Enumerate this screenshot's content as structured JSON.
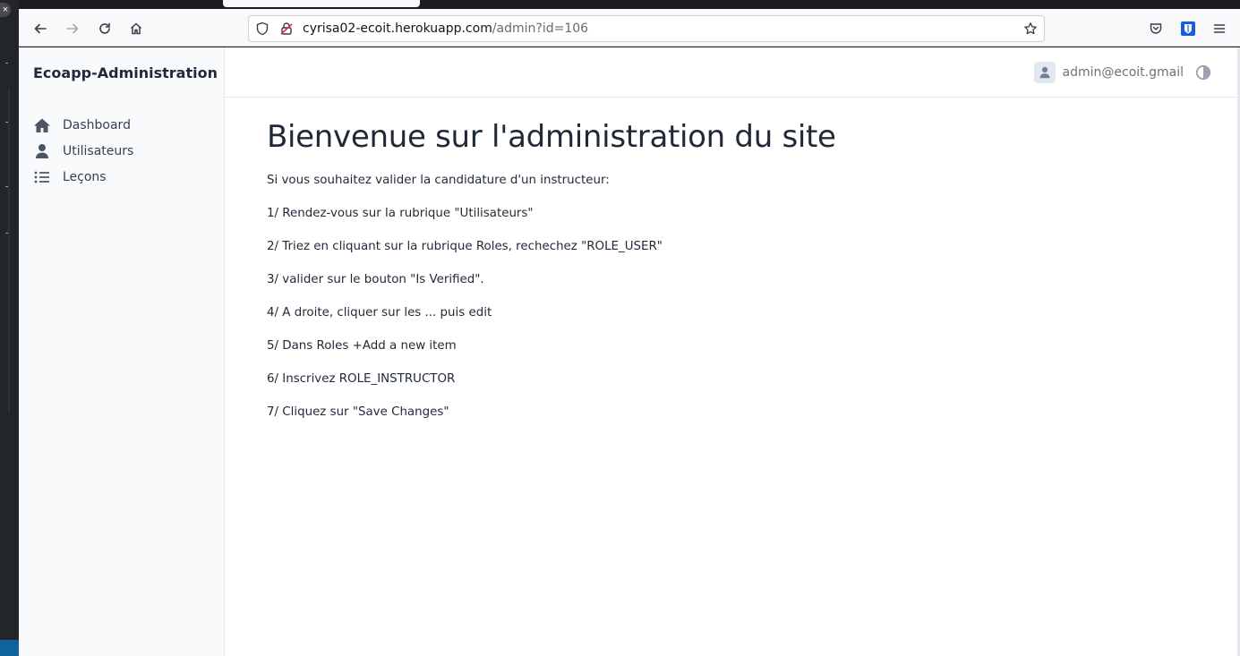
{
  "browser": {
    "url_host": "cyrisa02-ecoit.herokuapp.com",
    "url_path": "/admin?id=106",
    "left_strip_close": "×",
    "icons": [
      "back-arrow-icon",
      "forward-arrow-icon",
      "reload-icon",
      "home-icon",
      "shield-icon",
      "lock-icon",
      "star-icon",
      "pocket-icon",
      "extension-icon",
      "menu-icon"
    ]
  },
  "sidebar": {
    "brand": "Ecoapp-Administration",
    "items": [
      {
        "label": "Dashboard",
        "icon": "home-icon"
      },
      {
        "label": "Utilisateurs",
        "icon": "user-icon"
      },
      {
        "label": "Leçons",
        "icon": "list-icon"
      }
    ]
  },
  "header": {
    "user_email": "admin@ecoit.gmail",
    "avatar_icon": "user-icon",
    "theme_icon": "contrast-icon"
  },
  "main": {
    "title": "Bienvenue sur l'administration du site",
    "intro": "Si vous souhaitez valider la candidature d'un instructeur:",
    "steps": [
      "1/ Rendez-vous sur la rubrique \"Utilisateurs\"",
      "2/ Triez en cliquant sur la rubrique Roles, rechechez \"ROLE_USER\"",
      "3/ valider sur le bouton \"Is Verified\".",
      "4/ A droite, cliquer sur les ... puis edit",
      "5/ Dans Roles +Add a new item",
      "6/ Inscrivez ROLE_INSTRUCTOR",
      "7/ Cliquez sur \"Save Changes\""
    ]
  },
  "colors": {
    "sidebar_bg": "#f8fafc",
    "text": "#1f2937",
    "muted": "#6b7280",
    "browser_chrome": "#f9f9fb"
  }
}
